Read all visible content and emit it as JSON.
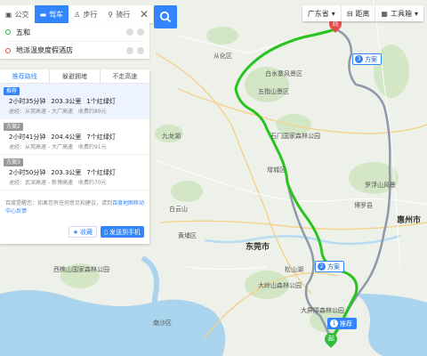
{
  "colors": {
    "accent": "#3385ff",
    "route_main": "#27c41e",
    "route_alt": "#8e98a8",
    "start_pin": "#2fbd3c",
    "end_pin": "#e84c4c"
  },
  "panel": {
    "modes": [
      {
        "label": "公交",
        "icon": "bus-icon"
      },
      {
        "label": "驾车",
        "icon": "car-icon"
      },
      {
        "label": "步行",
        "icon": "walk-icon"
      },
      {
        "label": "骑行",
        "icon": "bike-icon"
      }
    ],
    "start": "五和",
    "end": "地派温泉度假酒店",
    "route_tabs": [
      "推荐路线",
      "躲避拥堵",
      "不走高速"
    ],
    "plans": [
      {
        "tag": "推荐",
        "duration": "2小时35分钟",
        "distance": "203.3公里",
        "lights": "1个红绿灯",
        "via": "途经：从莞高速 - 大广高速",
        "toll": "收费约89元"
      },
      {
        "tag": "方案2",
        "duration": "2小时41分钟",
        "distance": "204.4公里",
        "lights": "7个红绿灯",
        "via": "途经：从莞高速 - 大广高速",
        "toll": "收费约91元"
      },
      {
        "tag": "方案3",
        "duration": "2小时50分钟",
        "distance": "203.3公里",
        "lights": "7个红绿灯",
        "via": "途经：武深高速 - 新博高速",
        "toll": "收费约70元"
      }
    ],
    "tip_text": "百度提醒您：如果您有任何意见和建议，请到",
    "tip_link": "百度地图移动中心反馈",
    "fav_label": "收藏",
    "send_label": "发送到手机"
  },
  "toolbar": {
    "city": "广东省",
    "scale": "距离",
    "tools": "工具箱"
  },
  "map": {
    "badges": {
      "start": "推荐",
      "alt2": "方案",
      "alt3": "方案"
    },
    "labels": {
      "dongguan": "东莞市",
      "huizhou": "惠州市",
      "zengcheng": "增城区",
      "conghua": "从化区",
      "huadu": "九龙湖",
      "luofu": "罗浮山风景",
      "baishui": "白水寨风景区",
      "shimen": "石门国家森林公园",
      "wuhe": "五指山景区",
      "boluo": "博罗县",
      "qiaotou": "大岭山森林公园",
      "songshan": "松山湖",
      "dapeng": "大屏障森林公园",
      "nansha": "南沙区",
      "xixiang": "西樵山国家森林公园",
      "baiyun": "白云山",
      "huangpu": "黄埔区"
    }
  }
}
